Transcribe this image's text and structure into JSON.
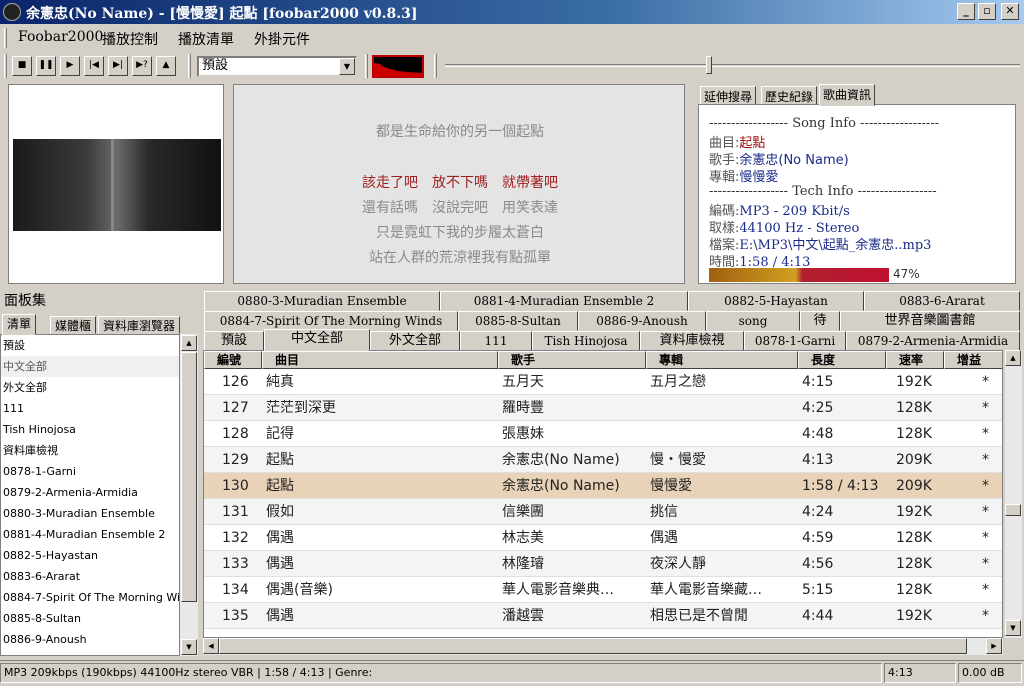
{
  "window": {
    "title": "余憲忠(No Name) - [慢慢愛] 起點    [foobar2000 v0.8.3]",
    "minimize": "_",
    "maximize": "▫",
    "close": "✕"
  },
  "menu": {
    "items": [
      "Foobar2000",
      "播放控制",
      "播放清單",
      "外掛元件"
    ]
  },
  "toolbar": {
    "buttons": [
      {
        "name": "stop",
        "glyph": "■"
      },
      {
        "name": "pause",
        "glyph": "❚❚"
      },
      {
        "name": "play",
        "glyph": "▶"
      },
      {
        "name": "previous",
        "glyph": "|◀"
      },
      {
        "name": "next",
        "glyph": "▶|"
      },
      {
        "name": "random",
        "glyph": "▶?"
      },
      {
        "name": "open",
        "glyph": "▲"
      }
    ],
    "preset": "預設"
  },
  "lyrics": {
    "lines": [
      {
        "text": "都是生命給你的另一個起點",
        "highlight": false
      },
      {
        "text": "該走了吧　放不下嗎　就帶著吧",
        "highlight": true
      },
      {
        "text": "還有話嗎　沒說完吧　用笑表達",
        "highlight": false
      },
      {
        "text": "只是霓虹下我的步履太蒼白",
        "highlight": false
      },
      {
        "text": "站在人群的荒涼裡我有點孤單",
        "highlight": false
      }
    ]
  },
  "info_tabs": [
    "延伸搜尋",
    "歷史紀錄",
    "歌曲資訊"
  ],
  "song_info": {
    "section_song": "------------------ Song Info ------------------",
    "title_label": "曲目:",
    "title": "起點",
    "artist_label": "歌手:",
    "artist": "余憲忠(No Name)",
    "album_label": "專輯:",
    "album": "慢慢愛",
    "section_tech": "------------------ Tech Info ------------------",
    "codec_label": "編碼:",
    "codec": "MP3 - 209 Kbit/s",
    "sample_label": "取樣:",
    "sample": "44100 Hz -  Stereo",
    "file_label": "檔案:",
    "file": "E:\\MP3\\中文\\起點_余憲忠..mp3",
    "time_label": "時間:",
    "time": "1:58 / 4:13",
    "progress_percent": "47%"
  },
  "sidebar": {
    "label": "面板集",
    "tabs": [
      "清單",
      "媒體櫃",
      "資料庫瀏覽器"
    ],
    "items": [
      "預設",
      "中文全部",
      "外文全部",
      "111",
      "Tish Hinojosa",
      "資料庫檢視",
      "0878-1-Garni",
      "0879-2-Armenia-Armidia",
      "0880-3-Muradian Ensemble",
      "0881-4-Muradian Ensemble 2",
      "0882-5-Hayastan",
      "0883-6-Ararat",
      "0884-7-Spirit Of The Morning Winds",
      "0885-8-Sultan",
      "0886-9-Anoush"
    ]
  },
  "playlist_tabs": {
    "row1": [
      "0880-3-Muradian Ensemble",
      "0881-4-Muradian Ensemble 2",
      "0882-5-Hayastan",
      "0883-6-Ararat"
    ],
    "row2": [
      "0884-7-Spirit Of The Morning Winds",
      "0885-8-Sultan",
      "0886-9-Anoush",
      "song",
      "待",
      "世界音樂圖書館"
    ],
    "row3": [
      "預設",
      "中文全部",
      "外文全部",
      "111",
      "Tish Hinojosa",
      "資料庫檢視",
      "0878-1-Garni",
      "0879-2-Armenia-Armidia"
    ]
  },
  "table": {
    "headers": [
      "編號",
      "曲目",
      "歌手",
      "專輯",
      "長度",
      "速率",
      "增益"
    ],
    "rows": [
      [
        "126",
        "純真",
        "五月天",
        "五月之戀",
        "4:15",
        "192K",
        "*"
      ],
      [
        "127",
        "茫茫到深更",
        "羅時豐",
        "",
        "4:25",
        "128K",
        "*"
      ],
      [
        "128",
        "記得",
        "張惠妹",
        "",
        "4:48",
        "128K",
        "*"
      ],
      [
        "129",
        "起點",
        "余憲忠(No Name)",
        "慢・慢愛",
        "4:13",
        "209K",
        "*"
      ],
      [
        "130",
        "起點",
        "余憲忠(No Name)",
        "慢慢愛",
        "1:58 / 4:13",
        "209K",
        "*"
      ],
      [
        "131",
        "假如",
        "信樂團",
        "挑信",
        "4:24",
        "192K",
        "*"
      ],
      [
        "132",
        "偶遇",
        "林志美",
        "偶遇",
        "4:59",
        "128K",
        "*"
      ],
      [
        "133",
        "偶遇",
        "林隆璿",
        "夜深人靜",
        "4:56",
        "128K",
        "*"
      ],
      [
        "134",
        "偶遇(音樂)",
        "華人電影音樂典…",
        "華人電影音樂藏…",
        "5:15",
        "128K",
        "*"
      ],
      [
        "135",
        "偶遇",
        "潘越雲",
        "相思已是不曾閒",
        "4:44",
        "192K",
        "*"
      ]
    ],
    "current_index": 4
  },
  "status": {
    "main": "MP3 209kbps (190kbps) 44100Hz stereo VBR  |  1:58 / 4:13  |  Genre:",
    "length": "4:13",
    "gain": "0.00 dB"
  }
}
